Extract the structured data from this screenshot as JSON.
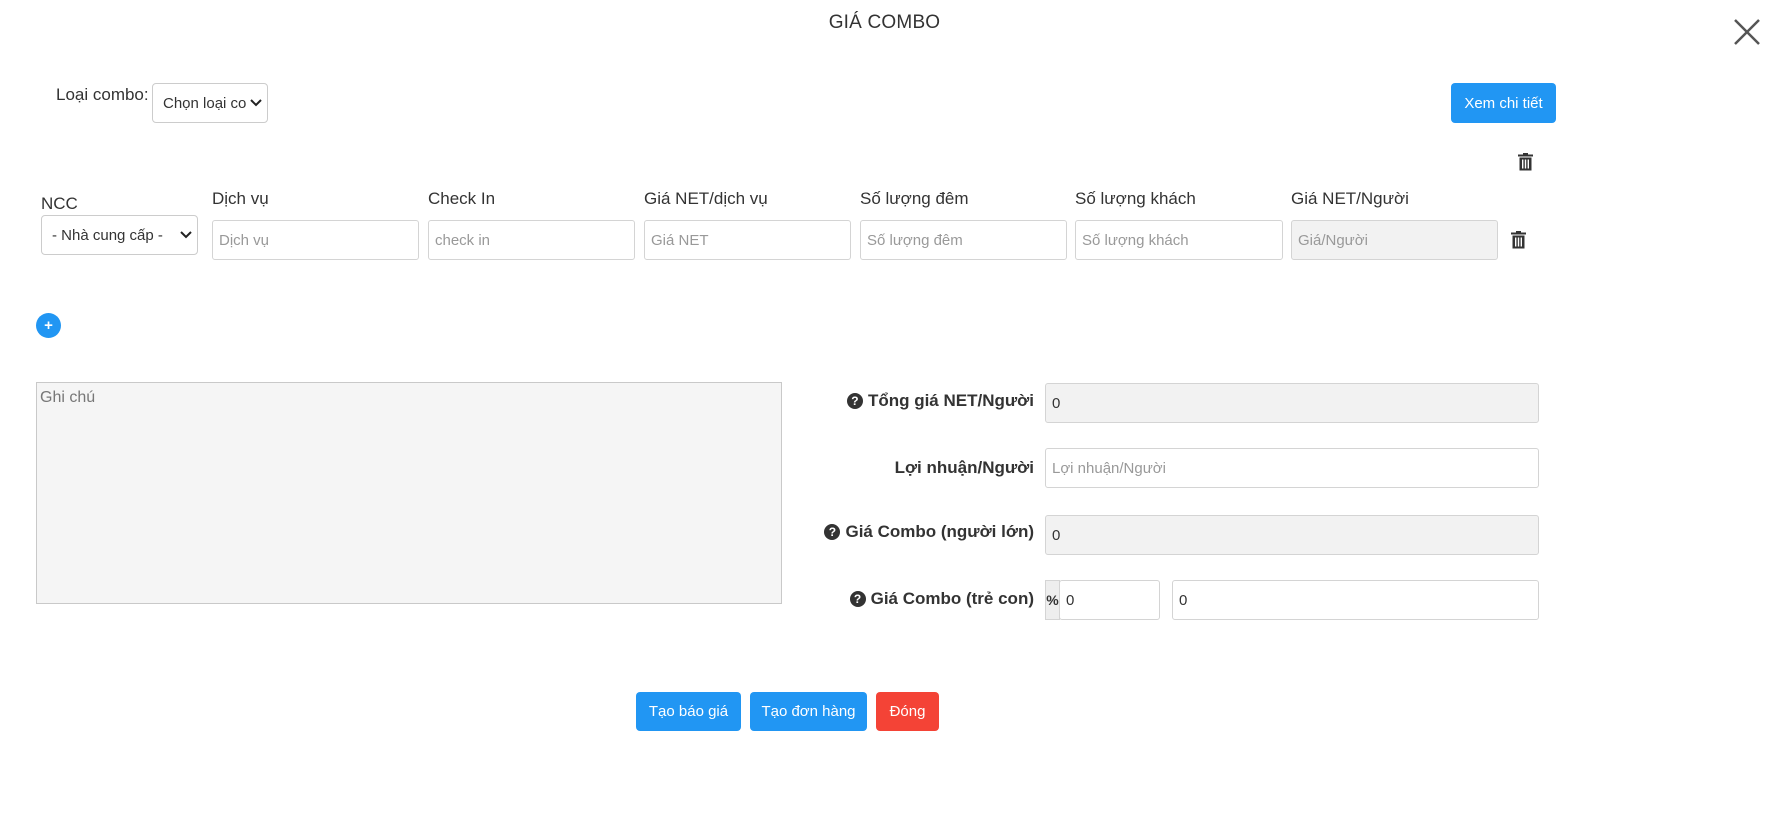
{
  "dialog": {
    "title": "GIÁ COMBO",
    "close_icon": "close-icon"
  },
  "combo_type": {
    "label": "Loại combo:",
    "selected": "Chọn loại co"
  },
  "view_detail_button": "Xem chi tiết",
  "table": {
    "headers": [
      "NCC",
      "Dịch vụ",
      "Check In",
      "Giá NET/dịch vụ",
      "Số lượng đêm",
      "Số lượng khách",
      "Giá NET/Người"
    ],
    "row": {
      "supplier_selected": "- Nhà cung cấp -",
      "service_placeholder": "Dịch vụ",
      "checkin_placeholder": "check in",
      "net_price_placeholder": "Giá NET",
      "nights_placeholder": "Số lượng đêm",
      "guests_placeholder": "Số lượng khách",
      "price_per_person_placeholder": "Giá/Người"
    }
  },
  "add_row_button": "+",
  "note": {
    "placeholder": "Ghi chú"
  },
  "summary": {
    "total_net_label": "Tổng giá NET/Người",
    "total_net_value": "0",
    "profit_label": "Lợi nhuận/Người",
    "profit_placeholder": "Lợi nhuận/Người",
    "adult_combo_label": "Giá Combo (người lớn)",
    "adult_combo_value": "0",
    "child_combo_label": "Giá Combo (trẻ con)",
    "child_percent_symbol": "%",
    "child_percent_value": "0",
    "child_combo_value": "0",
    "help_symbol": "?"
  },
  "footer": {
    "create_quote": "Tạo báo giá",
    "create_order": "Tạo đơn hàng",
    "close": "Đóng"
  },
  "colors": {
    "primary": "#2196f3",
    "danger": "#f44336"
  }
}
